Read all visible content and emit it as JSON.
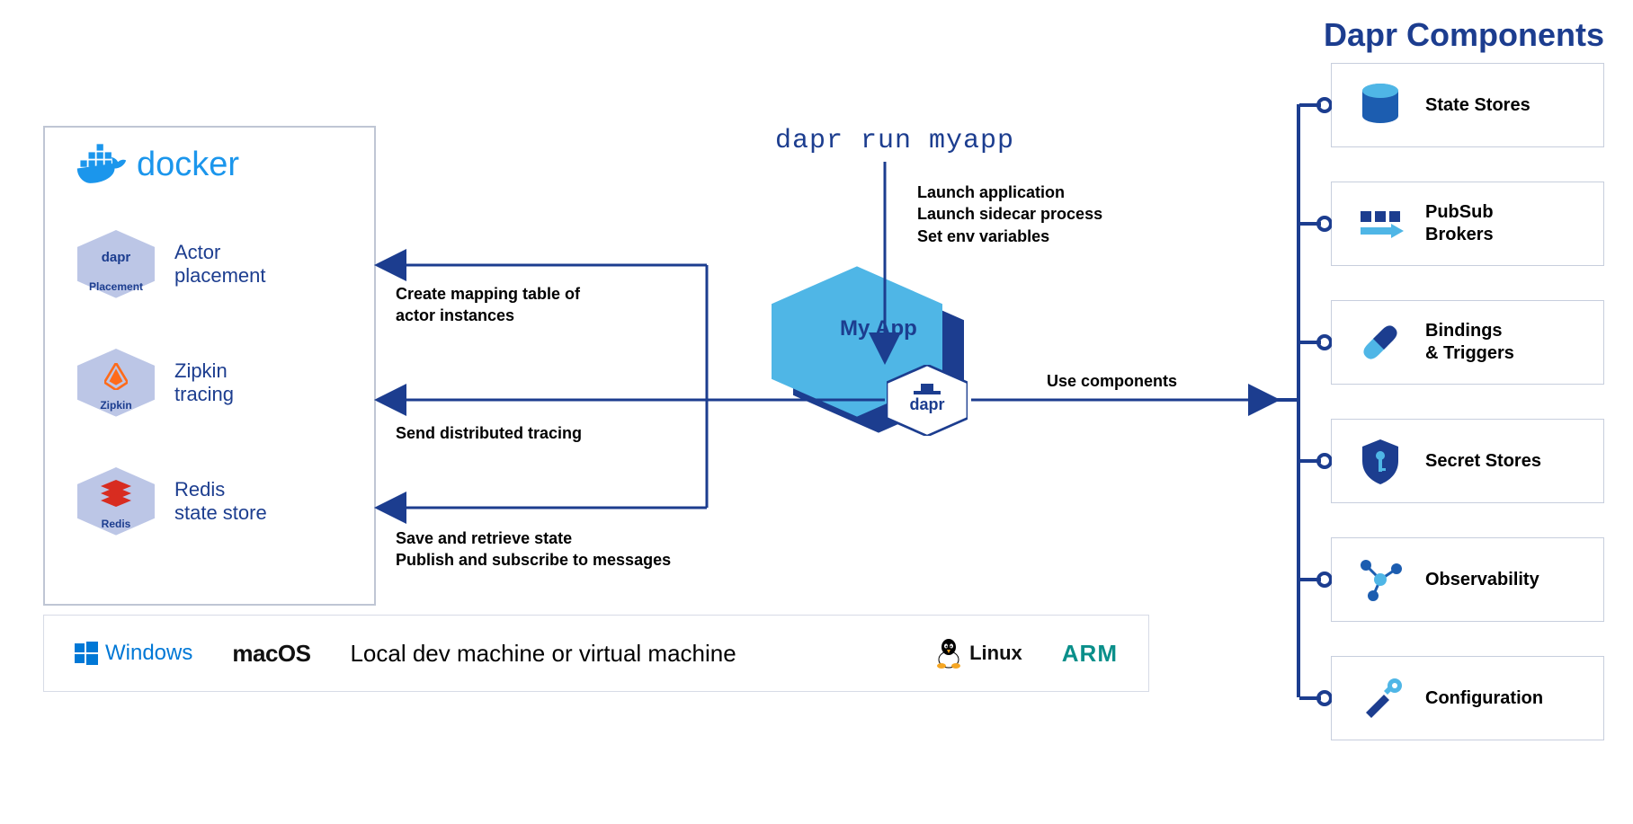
{
  "title": "Dapr Components",
  "command": "dapr run myapp",
  "command_sub": "Launch application\nLaunch sidecar process\nSet env variables",
  "myapp_label": "My App",
  "docker": {
    "brand": "docker",
    "items": [
      {
        "caption": "Placement",
        "label": "Actor\nplacement"
      },
      {
        "caption": "Zipkin",
        "label": "Zipkin\ntracing"
      },
      {
        "caption": "Redis",
        "label": "Redis\nstate store"
      }
    ]
  },
  "arrows": {
    "a1": "Create mapping table of\nactor instances",
    "a2": "Send distributed tracing",
    "a3": "Save and retrieve state\nPublish and subscribe to messages",
    "usec": "Use components"
  },
  "components": [
    {
      "label": "State Stores"
    },
    {
      "label": "PubSub\nBrokers"
    },
    {
      "label": "Bindings\n& Triggers"
    },
    {
      "label": "Secret Stores"
    },
    {
      "label": "Observability"
    },
    {
      "label": "Configuration"
    }
  ],
  "bottom": {
    "windows": "Windows",
    "macos": "macOS",
    "center": "Local dev machine or virtual machine",
    "linux": "Linux",
    "arm": "ARM"
  },
  "dapr_text": "dapr",
  "placement_top": "dapr"
}
